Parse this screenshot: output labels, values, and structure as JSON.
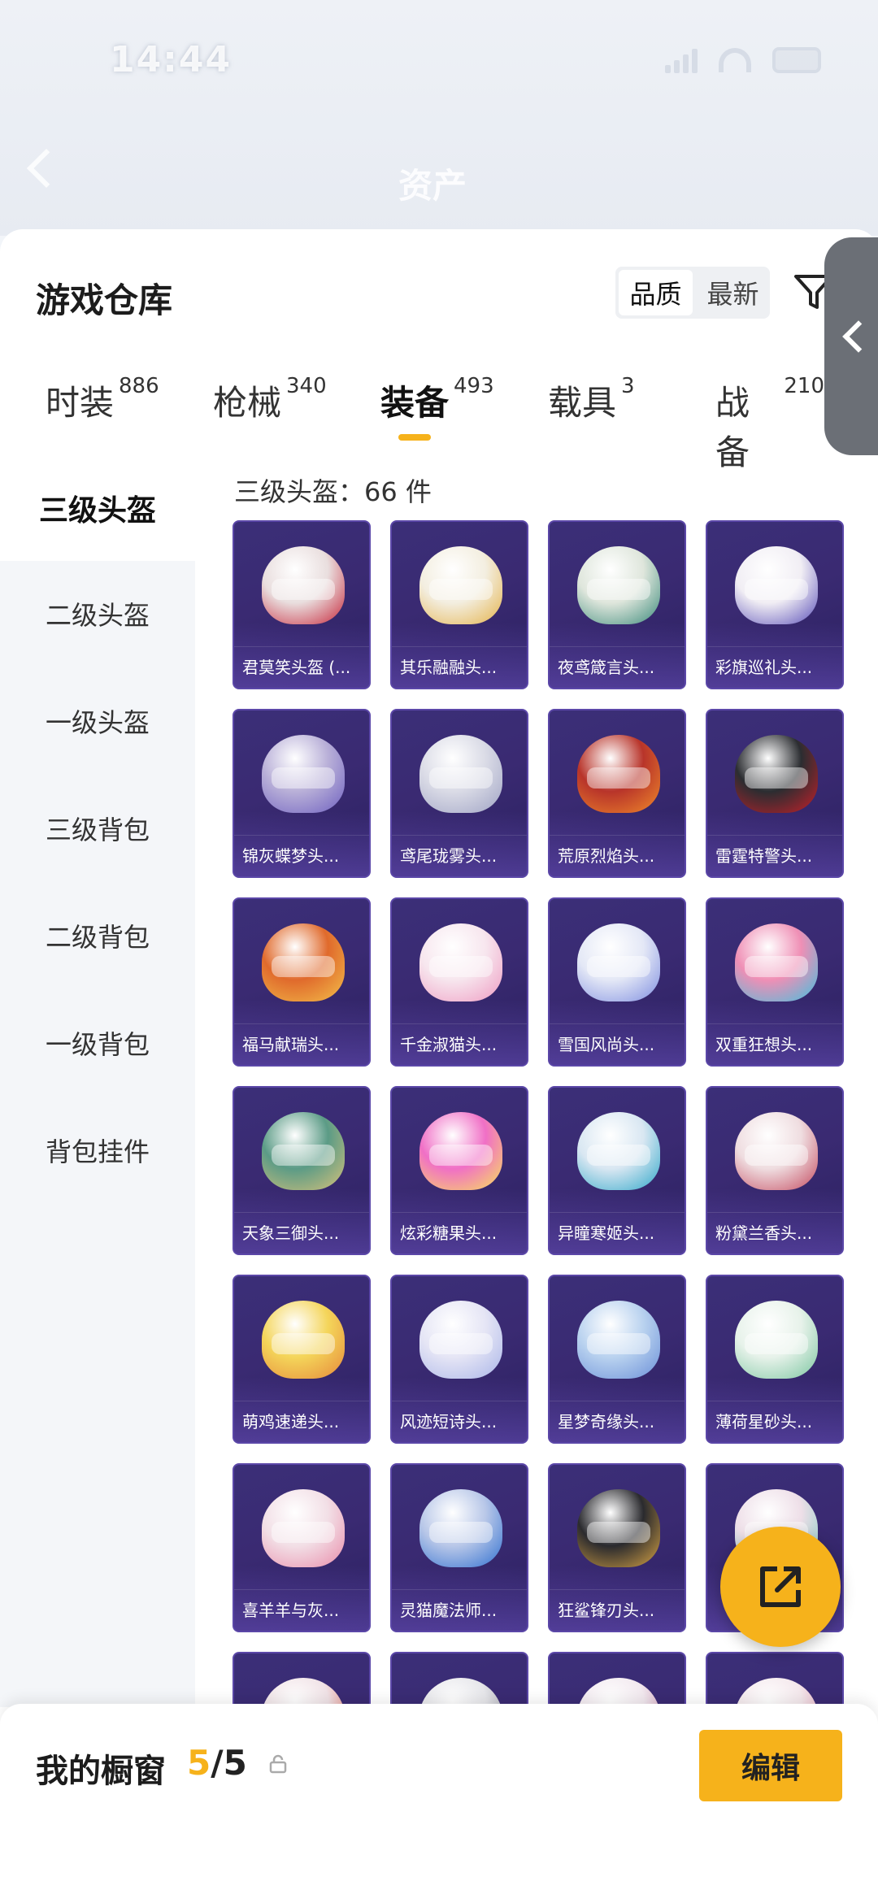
{
  "status_bar": {
    "time": "14:44"
  },
  "nav": {
    "title": "资产"
  },
  "sheet": {
    "title": "游戏仓库"
  },
  "sort": {
    "options": [
      "品质",
      "最新"
    ],
    "active": "品质"
  },
  "tabs": [
    {
      "label": "时装",
      "count": "886"
    },
    {
      "label": "枪械",
      "count": "340"
    },
    {
      "label": "装备",
      "count": "493"
    },
    {
      "label": "载具",
      "count": "3"
    },
    {
      "label": "战备",
      "count": "210"
    }
  ],
  "active_tab": "装备",
  "categories": [
    "三级头盔",
    "二级头盔",
    "一级头盔",
    "三级背包",
    "二级背包",
    "一级背包",
    "背包挂件"
  ],
  "active_category": "三级头盔",
  "count_line": "三级头盔：66 件",
  "items": [
    {
      "name": "君莫笑头盔 (...",
      "color": "#e9dede",
      "accent": "#c7263a"
    },
    {
      "name": "其乐融融头...",
      "color": "#f3eee0",
      "accent": "#e4b24a"
    },
    {
      "name": "夜鸢箴言头...",
      "color": "#dfe6dc",
      "accent": "#3a8a7a"
    },
    {
      "name": "彩旗巡礼头...",
      "color": "#f1eef4",
      "accent": "#5a4fb8"
    },
    {
      "name": "锦灰蝶梦头...",
      "color": "#b9b0d8",
      "accent": "#6e60c0"
    },
    {
      "name": "鸢尾珑雾头...",
      "color": "#dadbe6",
      "accent": "#9fa3c4"
    },
    {
      "name": "荒原烈焰头...",
      "color": "#b8342a",
      "accent": "#f08a2a"
    },
    {
      "name": "雷霆特警头...",
      "color": "#2b2d31",
      "accent": "#c8202a"
    },
    {
      "name": "福马献瑞头...",
      "color": "#e06a2c",
      "accent": "#f3c04a"
    },
    {
      "name": "千金淑猫头...",
      "color": "#f7e6ee",
      "accent": "#ee9ac1"
    },
    {
      "name": "雪国风尚头...",
      "color": "#e4e8f6",
      "accent": "#7d8de0"
    },
    {
      "name": "双重狂想头...",
      "color": "#ef8fb5",
      "accent": "#3fc1e0"
    },
    {
      "name": "天象三御头...",
      "color": "#5b9b86",
      "accent": "#d9c27a"
    },
    {
      "name": "炫彩糖果头...",
      "color": "#f06fc6",
      "accent": "#f8e35a"
    },
    {
      "name": "异瞳寒姬头...",
      "color": "#d9e7f2",
      "accent": "#2fa7c9"
    },
    {
      "name": "粉黛兰香头...",
      "color": "#efdde0",
      "accent": "#c44a5f"
    },
    {
      "name": "萌鸡速递头...",
      "color": "#f4d55a",
      "accent": "#e6883a"
    },
    {
      "name": "风迹短诗头...",
      "color": "#e5e5f5",
      "accent": "#a9b5e8"
    },
    {
      "name": "星梦奇缘头...",
      "color": "#b9d2ef",
      "accent": "#6a8fd8"
    },
    {
      "name": "薄荷星砂头...",
      "color": "#e7f2ea",
      "accent": "#7bc6a0"
    },
    {
      "name": "喜羊羊与灰...",
      "color": "#f2dfe6",
      "accent": "#e98ba9"
    },
    {
      "name": "灵猫魔法师...",
      "color": "#b8c7e8",
      "accent": "#2f6fd0"
    },
    {
      "name": "狂鲨锋刃头...",
      "color": "#2a2a2e",
      "accent": "#d9a545"
    },
    {
      "name": "",
      "color": "#eedfe8",
      "accent": "#7ac8c0"
    },
    {
      "name": "",
      "color": "#f0e2e6",
      "accent": "#e05a4a"
    },
    {
      "name": "",
      "color": "#e6e6ea",
      "accent": "#8a8a96"
    },
    {
      "name": "",
      "color": "#f2e9ef",
      "accent": "#c27aa0"
    },
    {
      "name": "",
      "color": "#f4e8ec",
      "accent": "#e08aa8"
    }
  ],
  "showcase": {
    "label": "我的橱窗",
    "used": "5",
    "total": "/5"
  },
  "edit_button": "编辑",
  "icons": {
    "filter": "filter-icon",
    "share": "share-icon",
    "lock": "lock-icon",
    "back": "back-arrow-icon"
  }
}
